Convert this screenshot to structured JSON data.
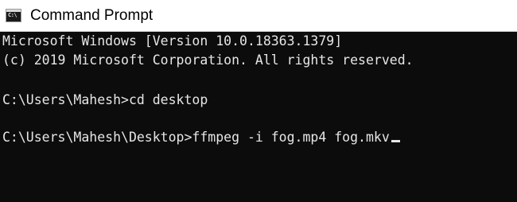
{
  "window": {
    "title": "Command Prompt",
    "icon": "cmd-icon",
    "icon_prompt": "C:\\"
  },
  "console": {
    "lines": [
      "Microsoft Windows [Version 10.0.18363.1379]",
      "(c) 2019 Microsoft Corporation. All rights reserved.",
      "",
      "C:\\Users\\Mahesh>cd desktop",
      "",
      "C:\\Users\\Mahesh\\Desktop>ffmpeg -i fog.mp4 fog.mkv"
    ]
  },
  "colors": {
    "console_background": "#0c0c0c",
    "console_text": "#e6e6e6",
    "titlebar_background": "#ffffff"
  }
}
